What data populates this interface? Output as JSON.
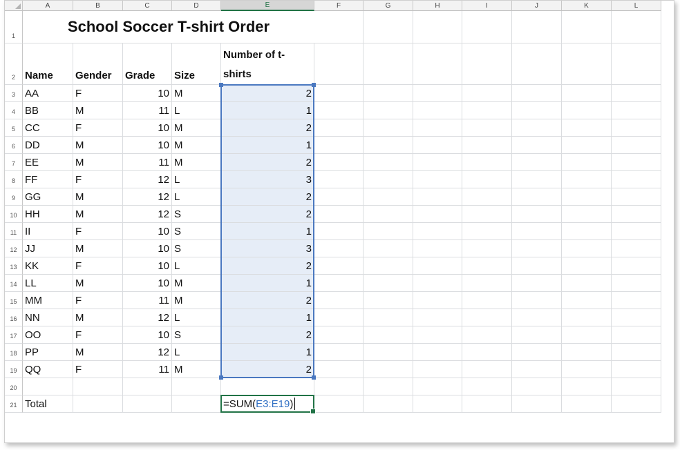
{
  "columns": [
    "A",
    "B",
    "C",
    "D",
    "E",
    "F",
    "G",
    "H",
    "I",
    "J",
    "K",
    "L"
  ],
  "selected_column": "E",
  "title": "School Soccer T-shirt Order",
  "headers": {
    "name": "Name",
    "gender": "Gender",
    "grade": "Grade",
    "size": "Size",
    "tshirts": "Number of t-shirts"
  },
  "rows": [
    {
      "row": "3",
      "name": "AA",
      "gender": "F",
      "grade": "10",
      "size": "M",
      "qty": "2"
    },
    {
      "row": "4",
      "name": "BB",
      "gender": "M",
      "grade": "11",
      "size": "L",
      "qty": "1"
    },
    {
      "row": "5",
      "name": "CC",
      "gender": "F",
      "grade": "10",
      "size": "M",
      "qty": "2"
    },
    {
      "row": "6",
      "name": "DD",
      "gender": "M",
      "grade": "10",
      "size": "M",
      "qty": "1"
    },
    {
      "row": "7",
      "name": "EE",
      "gender": "M",
      "grade": "11",
      "size": "M",
      "qty": "2"
    },
    {
      "row": "8",
      "name": "FF",
      "gender": "F",
      "grade": "12",
      "size": "L",
      "qty": "3"
    },
    {
      "row": "9",
      "name": "GG",
      "gender": "M",
      "grade": "12",
      "size": "L",
      "qty": "2"
    },
    {
      "row": "10",
      "name": "HH",
      "gender": "M",
      "grade": "12",
      "size": "S",
      "qty": "2"
    },
    {
      "row": "11",
      "name": "II",
      "gender": "F",
      "grade": "10",
      "size": "S",
      "qty": "1"
    },
    {
      "row": "12",
      "name": "JJ",
      "gender": "M",
      "grade": "10",
      "size": "S",
      "qty": "3"
    },
    {
      "row": "13",
      "name": "KK",
      "gender": "F",
      "grade": "10",
      "size": "L",
      "qty": "2"
    },
    {
      "row": "14",
      "name": "LL",
      "gender": "M",
      "grade": "10",
      "size": "M",
      "qty": "1"
    },
    {
      "row": "15",
      "name": "MM",
      "gender": "F",
      "grade": "11",
      "size": "M",
      "qty": "2"
    },
    {
      "row": "16",
      "name": "NN",
      "gender": "M",
      "grade": "12",
      "size": "L",
      "qty": "1"
    },
    {
      "row": "17",
      "name": "OO",
      "gender": "F",
      "grade": "10",
      "size": "S",
      "qty": "2"
    },
    {
      "row": "18",
      "name": "PP",
      "gender": "M",
      "grade": "12",
      "size": "L",
      "qty": "1"
    },
    {
      "row": "19",
      "name": "QQ",
      "gender": "F",
      "grade": "11",
      "size": "M",
      "qty": "2"
    }
  ],
  "blank_row": "20",
  "total_row": {
    "row": "21",
    "label": "Total",
    "formula_prefix": "=SUM(",
    "formula_ref": "E3:E19",
    "formula_suffix": ")"
  },
  "colors": {
    "selection_border": "#4a78c0",
    "selection_fill": "#e6edf7",
    "active_border": "#217346",
    "reference_text": "#2f6fc4"
  }
}
